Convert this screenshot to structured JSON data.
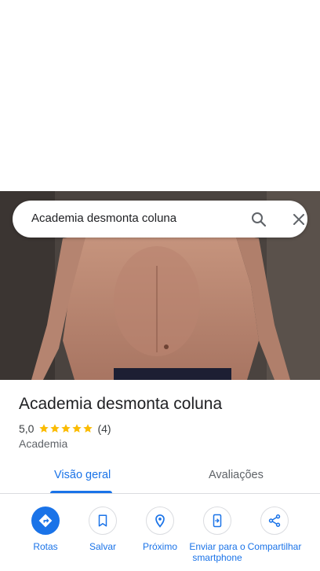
{
  "search": {
    "query": "Academia desmonta coluna",
    "search_icon": "search-icon",
    "close_icon": "close-icon"
  },
  "place": {
    "title": "Academia desmonta coluna",
    "rating": "5,0",
    "stars": 5,
    "review_count": "(4)",
    "category": "Academia",
    "star_color": "#fbbc04"
  },
  "tabs": [
    {
      "label": "Visão geral",
      "selected": true
    },
    {
      "label": "Avaliações",
      "selected": false
    }
  ],
  "actions": [
    {
      "label": "Rotas",
      "icon": "directions-icon"
    },
    {
      "label": "Salvar",
      "icon": "bookmark-icon"
    },
    {
      "label": "Próximo",
      "icon": "nearby-icon"
    },
    {
      "label": "Enviar para o smartphone",
      "icon": "send-to-phone-icon"
    },
    {
      "label": "Compartilhar",
      "icon": "share-icon"
    }
  ],
  "colors": {
    "accent": "#1a73e8",
    "text_primary": "#202124",
    "text_secondary": "#5f6368",
    "divider": "#dadce0"
  }
}
